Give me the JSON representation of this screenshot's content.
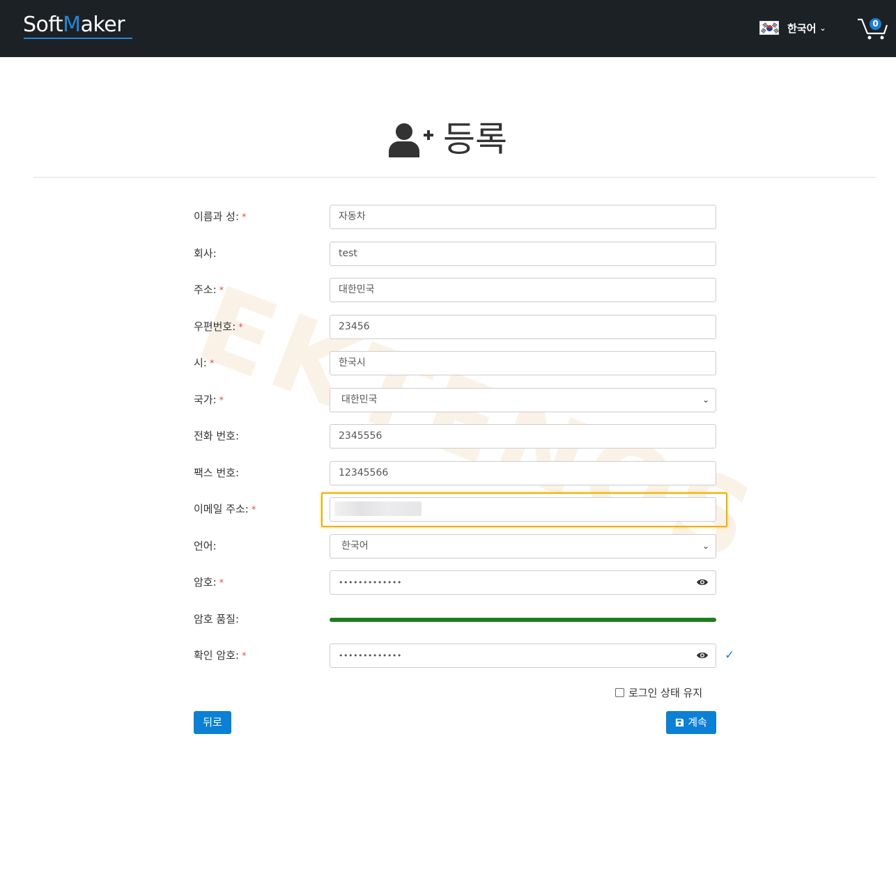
{
  "header": {
    "logo": {
      "part1": "Soft",
      "part2": "M",
      "part3": "aker"
    },
    "language": {
      "flag_icon": "flag-korea-icon",
      "label": "한국어"
    },
    "cart": {
      "count": "0",
      "icon": "shopping-cart-icon"
    }
  },
  "page": {
    "title": "등록",
    "title_icon": "user-plus-icon"
  },
  "watermark": "EKTENOS",
  "form": {
    "required_mark": "*",
    "full_name": {
      "label": "이름과 성:",
      "value": "자동차"
    },
    "company": {
      "label": "회사:",
      "value": "test"
    },
    "address": {
      "label": "주소:",
      "value": "대한민국"
    },
    "postal_code": {
      "label": "우편번호:",
      "value": "23456"
    },
    "city": {
      "label": "시:",
      "value": "한국시"
    },
    "country": {
      "label": "국가:",
      "value": "대한민국"
    },
    "phone": {
      "label": "전화 번호:",
      "value": "2345556"
    },
    "fax": {
      "label": "팩스 번호:",
      "value": "12345566"
    },
    "email": {
      "label": "이메일 주소:",
      "value": ""
    },
    "language": {
      "label": "언어:",
      "value": "한국어"
    },
    "password": {
      "label": "암호:",
      "value": "•••••••••••••"
    },
    "password_quality": {
      "label": "암호 품질:",
      "level": 1.0,
      "color": "#1e7e1e"
    },
    "confirm_password": {
      "label": "확인 암호:",
      "value": "•••••••••••••",
      "check": "✓"
    },
    "remember": {
      "label": "로그인 상태 유지",
      "checked": false
    }
  },
  "buttons": {
    "back": "뒤로",
    "continue": "계속"
  },
  "colors": {
    "topbar": "#1c2126",
    "accent": "#0c80d4",
    "highlight": "#f0b000"
  }
}
